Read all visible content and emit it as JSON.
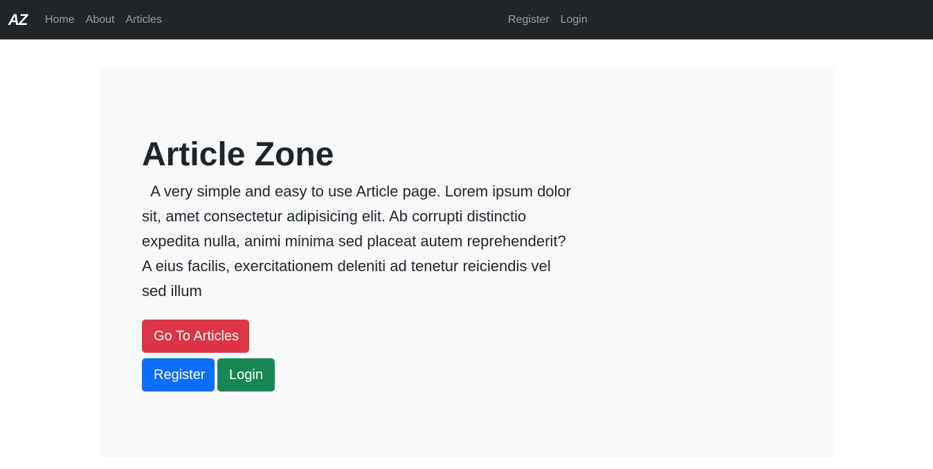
{
  "navbar": {
    "brand": "AZ",
    "left_links": [
      "Home",
      "About",
      "Articles"
    ],
    "right_links": [
      "Register",
      "Login"
    ]
  },
  "hero": {
    "title": "Article Zone",
    "text": "  A very simple and easy to use Article page. Lorem ipsum dolor sit, amet consectetur adipisicing elit. Ab corrupti distinctio expedita nulla, animi minima sed placeat autem reprehenderit? A eius facilis, exercitationem deleniti ad tenetur reiciendis vel sed illum",
    "buttons": {
      "articles": "Go To Articles",
      "register": "Register",
      "login": "Login"
    }
  },
  "colors": {
    "navbar_bg": "#212529",
    "jumbotron_bg": "#f8f9fa",
    "danger": "#dc3545",
    "primary": "#0d6efd",
    "success": "#198754"
  }
}
